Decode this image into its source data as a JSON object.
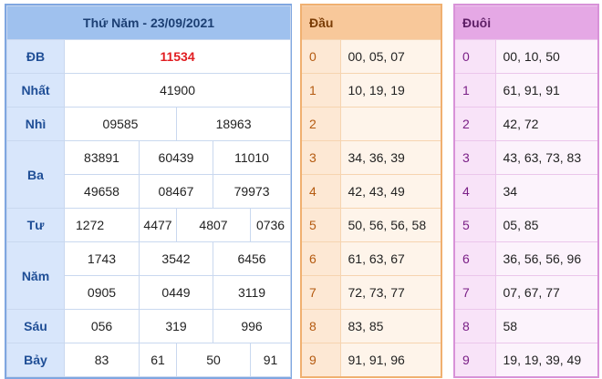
{
  "results": {
    "title": "Thứ Năm - 23/09/2021",
    "db": {
      "label": "ĐB",
      "value": "11534"
    },
    "nhat": {
      "label": "Nhất",
      "value": "41900"
    },
    "nhi": {
      "label": "Nhì",
      "values": [
        "09585",
        "18963"
      ]
    },
    "ba": {
      "label": "Ba",
      "values": [
        "83891",
        "60439",
        "11010",
        "49658",
        "08467",
        "79973"
      ]
    },
    "tu": {
      "label": "Tư",
      "values": [
        "1272",
        "4477",
        "4807",
        "0736"
      ]
    },
    "nam": {
      "label": "Năm",
      "values": [
        "1743",
        "3542",
        "6456",
        "0905",
        "0449",
        "3119"
      ]
    },
    "sau": {
      "label": "Sáu",
      "values": [
        "056",
        "319",
        "996"
      ]
    },
    "bay": {
      "label": "Bảy",
      "values": [
        "83",
        "61",
        "50",
        "91"
      ]
    }
  },
  "dau": {
    "title": "Đầu",
    "rows": [
      {
        "key": "0",
        "value": "00, 05, 07"
      },
      {
        "key": "1",
        "value": "10, 19, 19"
      },
      {
        "key": "2",
        "value": ""
      },
      {
        "key": "3",
        "value": "34, 36, 39"
      },
      {
        "key": "4",
        "value": "42, 43, 49"
      },
      {
        "key": "5",
        "value": "50, 56, 56, 58"
      },
      {
        "key": "6",
        "value": "61, 63, 67"
      },
      {
        "key": "7",
        "value": "72, 73, 77"
      },
      {
        "key": "8",
        "value": "83, 85"
      },
      {
        "key": "9",
        "value": "91, 91, 96"
      }
    ]
  },
  "duoi": {
    "title": "Đuôi",
    "rows": [
      {
        "key": "0",
        "value": "00, 10, 50"
      },
      {
        "key": "1",
        "value": "61, 91, 91"
      },
      {
        "key": "2",
        "value": "42, 72"
      },
      {
        "key": "3",
        "value": "43, 63, 73, 83"
      },
      {
        "key": "4",
        "value": "34"
      },
      {
        "key": "5",
        "value": "05, 85"
      },
      {
        "key": "6",
        "value": "36, 56, 56, 96"
      },
      {
        "key": "7",
        "value": "07, 67, 77"
      },
      {
        "key": "8",
        "value": "58"
      },
      {
        "key": "9",
        "value": "19, 19, 39, 49"
      }
    ]
  },
  "colors": {
    "results_border": "#7fa6e0",
    "dau_border": "#f0b070",
    "duoi_border": "#d892d8",
    "special_prize": "#e11d21"
  }
}
